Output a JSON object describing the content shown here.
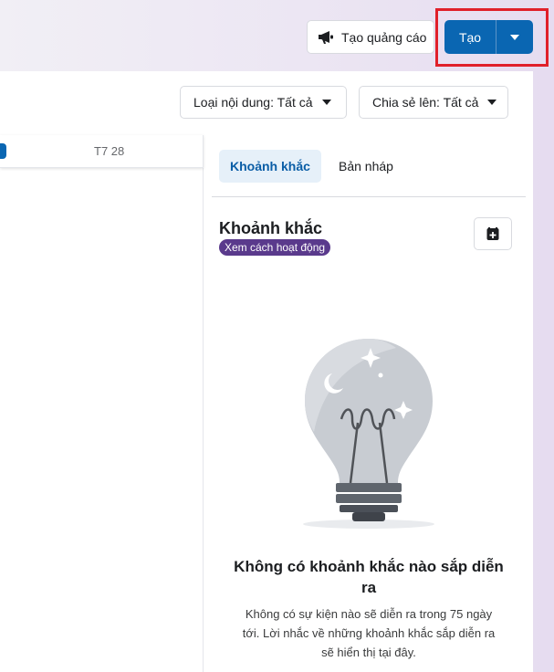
{
  "header": {
    "ad_button_label": "Tạo quảng cáo",
    "ad_icon": "megaphone-icon",
    "create_button_label": "Tạo",
    "create_dropdown_icon": "caret-down-icon"
  },
  "filters": {
    "content_type_label": "Loại nội dung: Tất cả",
    "share_to_label": "Chia sẻ lên: Tất cả"
  },
  "calendar": {
    "day_label": "T7 28"
  },
  "moments": {
    "tabs": [
      {
        "label": "Khoảnh khắc",
        "active": true
      },
      {
        "label": "Bản nháp",
        "active": false
      }
    ],
    "title": "Khoảnh khắc",
    "how_it_works": "Xem cách hoạt động",
    "add_icon": "add-calendar-icon",
    "illustration": "lightbulb-icon",
    "empty_title": "Không có khoảnh khắc nào sắp diễn ra",
    "empty_description": "Không có sự kiện nào sẽ diễn ra trong 75 ngày tới. Lời nhắc về những khoảnh khắc sắp diễn ra sẽ hiển thị tại đây."
  },
  "colors": {
    "primary": "#0a66b2",
    "highlight_annotation": "#e0202a",
    "badge": "#5a3a8c"
  }
}
